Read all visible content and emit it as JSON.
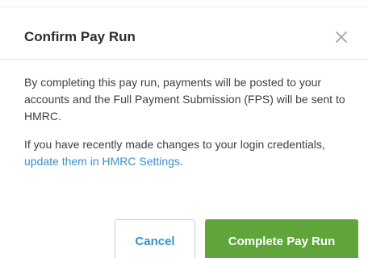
{
  "dialog": {
    "title": "Confirm Pay Run",
    "paragraph1": "By completing this pay run, payments will be posted to your accounts and the Full Payment Submission (FPS) will be sent to HMRC.",
    "paragraph2_before": "If you have recently made changes to your login credentials, ",
    "paragraph2_link": "update them in HMRC Settings",
    "paragraph2_after": ".",
    "close_icon": "close-icon"
  },
  "buttons": {
    "cancel_label": "Cancel",
    "confirm_label": "Complete Pay Run"
  },
  "colors": {
    "primary": "#5fa53a",
    "link": "#3b8fc9",
    "text": "#3a3f44",
    "title": "#2b2f33"
  }
}
